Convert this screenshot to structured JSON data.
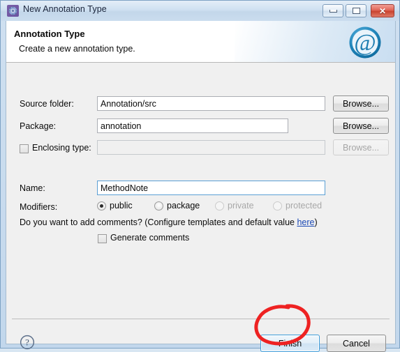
{
  "window": {
    "title": "New Annotation Type",
    "icon": "annotation-gear-icon",
    "controls": {
      "minimize": "minimize-icon",
      "maximize": "restore-icon",
      "close": "close-icon"
    }
  },
  "header": {
    "title": "Annotation Type",
    "subtitle": "Create a new annotation type.",
    "logo": "at-sign-logo",
    "logo_color": "#1b7cb0"
  },
  "form": {
    "source_folder": {
      "label": "Source folder:",
      "value": "Annotation/src",
      "placeholder": "",
      "browse_label": "Browse...",
      "browse_enabled": true
    },
    "package": {
      "label": "Package:",
      "value": "annotation",
      "placeholder": "",
      "browse_label": "Browse...",
      "browse_enabled": true
    },
    "enclosing_type": {
      "label": "Enclosing type:",
      "checked": false,
      "value": "",
      "placeholder": "",
      "browse_label": "Browse...",
      "browse_enabled": false
    },
    "name": {
      "label": "Name:",
      "value": "MethodNote",
      "placeholder": ""
    },
    "modifiers": {
      "label": "Modifiers:",
      "options": [
        {
          "label": "public",
          "selected": true,
          "enabled": true
        },
        {
          "label": "package",
          "selected": false,
          "enabled": true
        },
        {
          "label": "private",
          "selected": false,
          "enabled": false
        },
        {
          "label": "protected",
          "selected": false,
          "enabled": false
        }
      ]
    },
    "comments": {
      "question_before_link": "Do you want to add comments? (Configure templates and default value ",
      "link_label": "here",
      "question_after_link": ")",
      "checkbox_label": "Generate comments",
      "checkbox_checked": false
    }
  },
  "footer": {
    "help_label": "?",
    "help_icon": "help-question-icon",
    "finish_label": "Finish",
    "cancel_label": "Cancel"
  },
  "annotation": {
    "type": "hand-drawn-circle",
    "target": "Finish",
    "color": "#ee2222"
  }
}
